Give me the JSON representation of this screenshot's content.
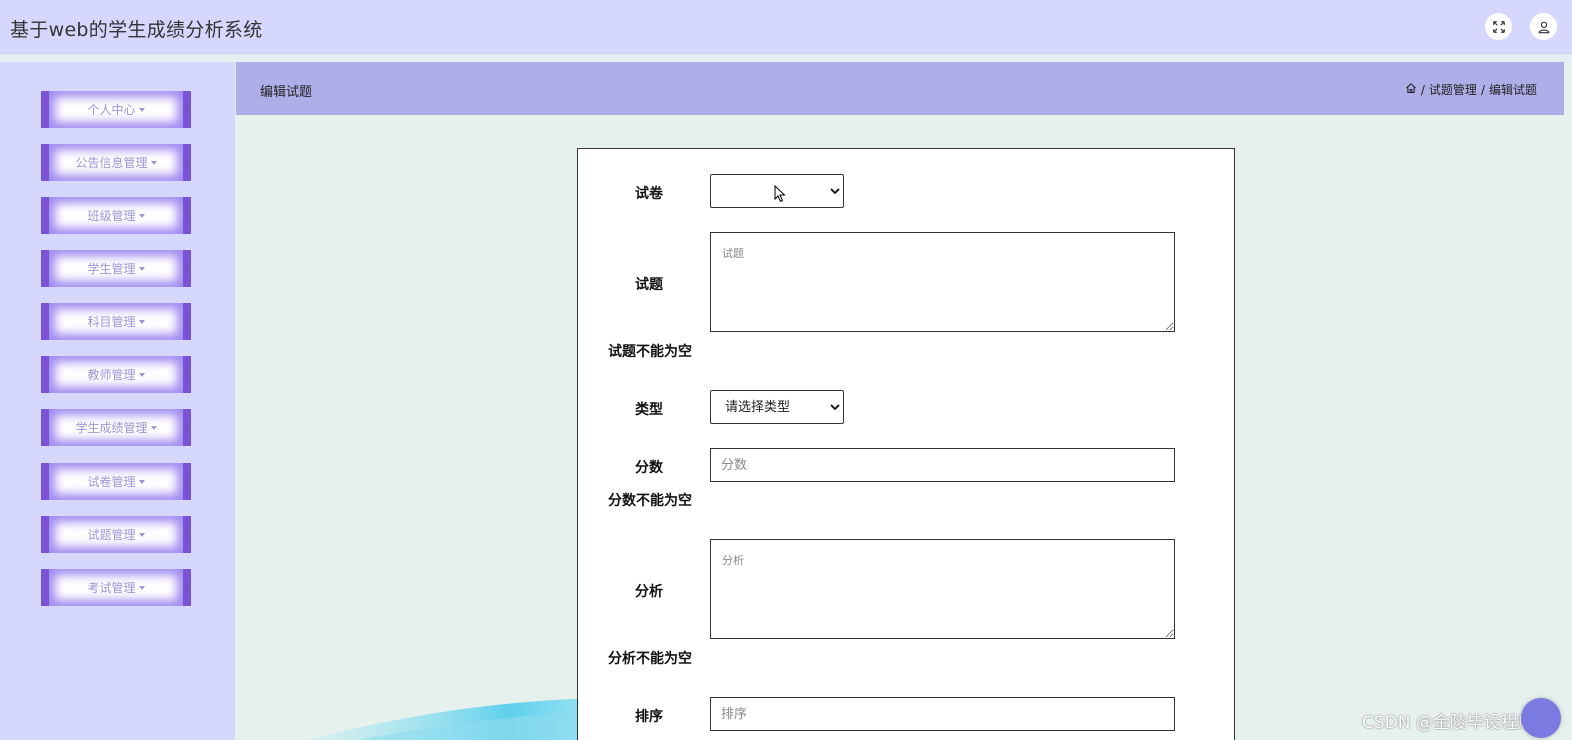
{
  "app": {
    "title": "基于web的学生成绩分析系统"
  },
  "header": {
    "fullscreen_icon": "fullscreen-icon",
    "user_icon": "user-icon"
  },
  "sidebar": {
    "items": [
      {
        "label": "个人中心"
      },
      {
        "label": "公告信息管理"
      },
      {
        "label": "班级管理"
      },
      {
        "label": "学生管理"
      },
      {
        "label": "科目管理"
      },
      {
        "label": "教师管理"
      },
      {
        "label": "学生成绩管理"
      },
      {
        "label": "试卷管理"
      },
      {
        "label": "试题管理"
      },
      {
        "label": "考试管理"
      }
    ]
  },
  "page": {
    "title": "编辑试题",
    "breadcrumb": [
      "试题管理",
      "编辑试题"
    ],
    "breadcrumb_sep": "/"
  },
  "form": {
    "paper_label": "试卷",
    "paper_value": "",
    "question_label": "试题",
    "question_placeholder": "试题",
    "question_error": "试题不能为空",
    "type_label": "类型",
    "type_value": "请选择类型",
    "score_label": "分数",
    "score_placeholder": "分数",
    "score_error": "分数不能为空",
    "analysis_label": "分析",
    "analysis_placeholder": "分析",
    "analysis_error": "分析不能为空",
    "order_label": "排序",
    "order_placeholder": "排序"
  },
  "watermark": "CSDN @金陵毕设程序",
  "colors": {
    "header_bg": "#d6d7fd",
    "breadcrumb_bg": "#aeaee8",
    "menu_accent": "#7a52d6",
    "page_bg": "#e6f0ec"
  }
}
